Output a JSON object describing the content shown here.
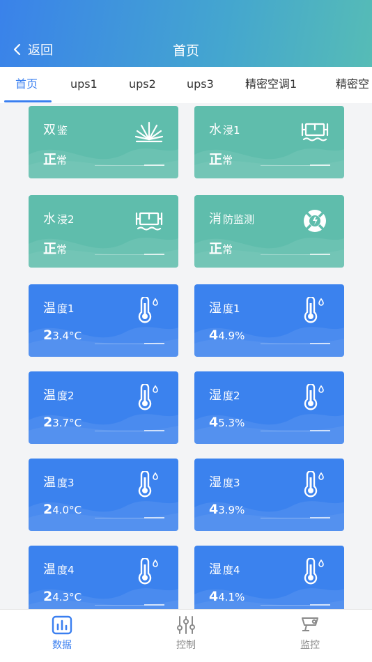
{
  "header": {
    "back_label": "返回",
    "title": "首页"
  },
  "tabs": [
    {
      "label": "首页",
      "active": true
    },
    {
      "label": "ups1"
    },
    {
      "label": "ups2"
    },
    {
      "label": "ups3"
    },
    {
      "label": "精密空调1"
    },
    {
      "label": "精密空"
    }
  ],
  "cards": [
    {
      "title_a": "双",
      "title_b": "鉴",
      "value_a": "正",
      "value_b": "常",
      "icon": "smoke-detector-icon",
      "color": "teal"
    },
    {
      "title_a": "水",
      "title_b": "浸1",
      "value_a": "正",
      "value_b": "常",
      "icon": "water-leak-icon",
      "color": "teal"
    },
    {
      "title_a": "水",
      "title_b": "浸2",
      "value_a": "正",
      "value_b": "常",
      "icon": "water-leak-icon",
      "color": "teal"
    },
    {
      "title_a": "消",
      "title_b": "防监测",
      "value_a": "正",
      "value_b": "常",
      "icon": "fire-alarm-icon",
      "color": "teal"
    },
    {
      "title_a": "温",
      "title_b": "度1",
      "value_a": "2",
      "value_b": "3.4°C",
      "icon": "thermometer-icon",
      "color": "blue"
    },
    {
      "title_a": "湿",
      "title_b": "度1",
      "value_a": "4",
      "value_b": "4.9%",
      "icon": "thermometer-icon",
      "color": "blue"
    },
    {
      "title_a": "温",
      "title_b": "度2",
      "value_a": "2",
      "value_b": "3.7°C",
      "icon": "thermometer-icon",
      "color": "blue"
    },
    {
      "title_a": "湿",
      "title_b": "度2",
      "value_a": "4",
      "value_b": "5.3%",
      "icon": "thermometer-icon",
      "color": "blue"
    },
    {
      "title_a": "温",
      "title_b": "度3",
      "value_a": "2",
      "value_b": "4.0°C",
      "icon": "thermometer-icon",
      "color": "blue"
    },
    {
      "title_a": "湿",
      "title_b": "度3",
      "value_a": "4",
      "value_b": "3.9%",
      "icon": "thermometer-icon",
      "color": "blue"
    },
    {
      "title_a": "温",
      "title_b": "度4",
      "value_a": "2",
      "value_b": "4.3°C",
      "icon": "thermometer-icon",
      "color": "blue"
    },
    {
      "title_a": "湿",
      "title_b": "度4",
      "value_a": "4",
      "value_b": "4.1%",
      "icon": "thermometer-icon",
      "color": "blue"
    }
  ],
  "bottom_nav": [
    {
      "label": "数据",
      "icon": "chart-icon",
      "active": true
    },
    {
      "label": "控制",
      "icon": "sliders-icon"
    },
    {
      "label": "监控",
      "icon": "camera-icon"
    }
  ],
  "colors": {
    "accent": "#3a7ff0",
    "teal": "#5fbdac",
    "blue": "#3b82ee"
  }
}
